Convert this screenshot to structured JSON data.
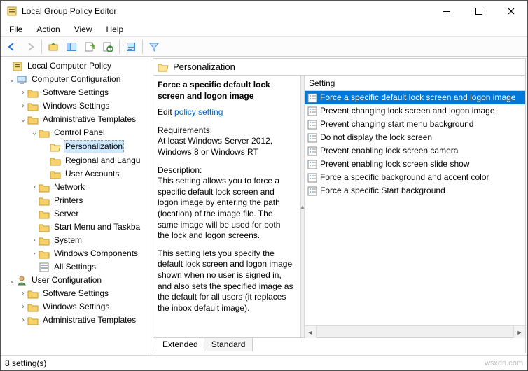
{
  "window": {
    "title": "Local Group Policy Editor"
  },
  "menubar": [
    "File",
    "Action",
    "View",
    "Help"
  ],
  "tree": {
    "root": "Local Computer Policy",
    "computer_config": "Computer Configuration",
    "cc": {
      "software": "Software Settings",
      "windows": "Windows Settings",
      "admin": "Administrative Templates",
      "cp": "Control Panel",
      "personalization": "Personalization",
      "regional": "Regional and Langu",
      "user_accounts": "User Accounts",
      "network": "Network",
      "printers": "Printers",
      "server": "Server",
      "start_menu": "Start Menu and Taskba",
      "system": "System",
      "win_components": "Windows Components",
      "all_settings": "All Settings"
    },
    "user_config": "User Configuration",
    "uc": {
      "software": "Software Settings",
      "windows": "Windows Settings",
      "admin": "Administrative Templates"
    }
  },
  "category": "Personalization",
  "detail": {
    "name": "Force a specific default lock screen and logon image",
    "edit_label": "Edit",
    "edit_link": "policy setting",
    "req_head": "Requirements:",
    "req_body": "At least Windows Server 2012, Windows 8 or Windows RT",
    "desc_head": "Description:",
    "desc_p1": "This setting allows you to force a specific default lock screen and logon image by entering the path (location) of the image file. The same image will be used for both the lock and logon screens.",
    "desc_p2": "This setting lets you specify the default lock screen and logon image shown when no user is signed in, and also sets the specified image as the default for all users (it replaces the inbox default image)."
  },
  "list": {
    "header": "Setting",
    "items": [
      "Force a specific default lock screen and logon image",
      "Prevent changing lock screen and logon image",
      "Prevent changing start menu background",
      "Do not display the lock screen",
      "Prevent enabling lock screen camera",
      "Prevent enabling lock screen slide show",
      "Force a specific background and accent color",
      "Force a specific Start background"
    ]
  },
  "tabs": {
    "extended": "Extended",
    "standard": "Standard"
  },
  "status": "8 setting(s)",
  "watermark": "wsxdn.com"
}
